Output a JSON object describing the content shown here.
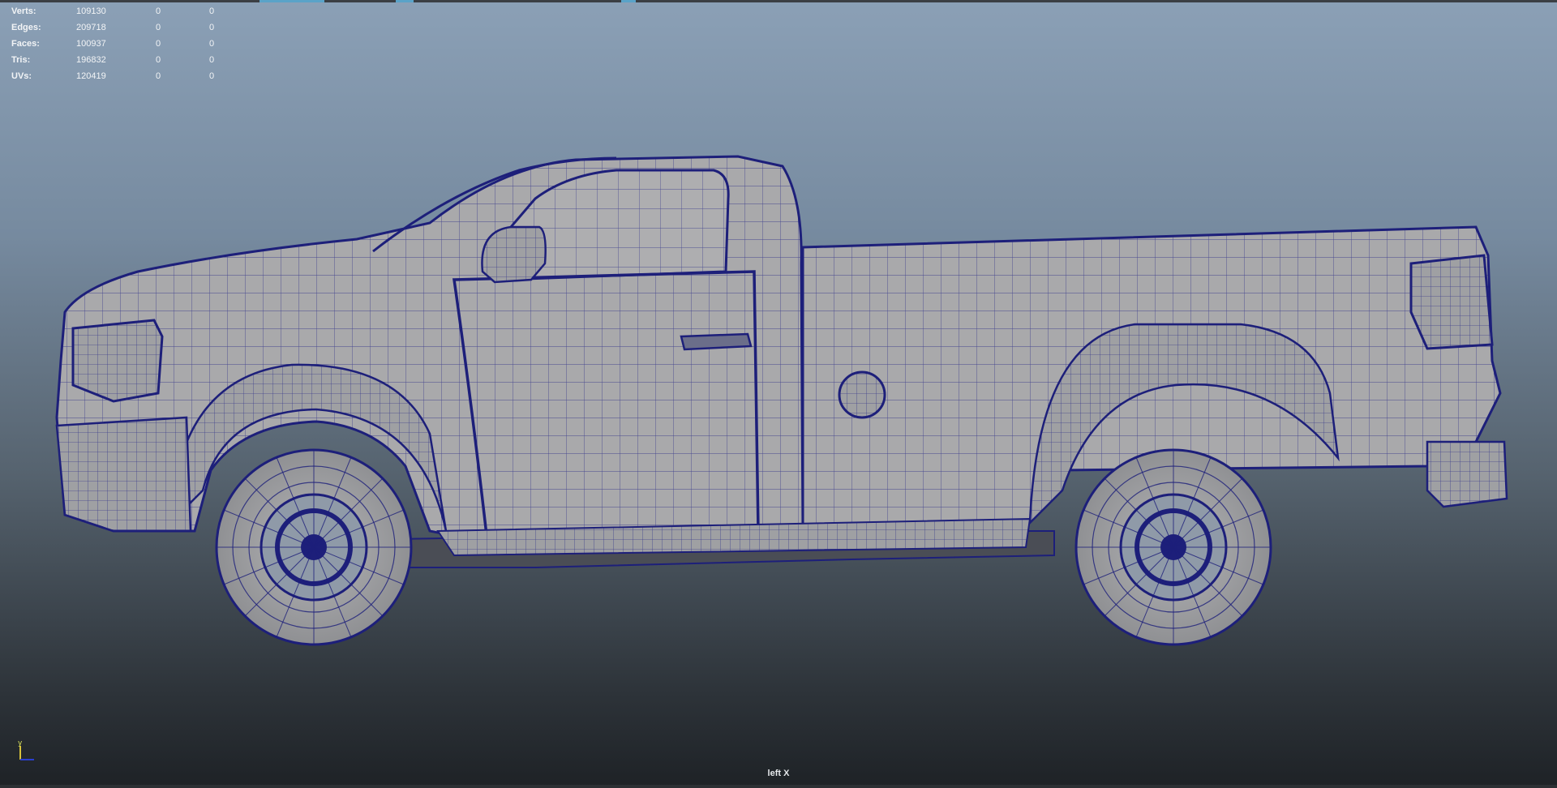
{
  "hud": {
    "rows": [
      {
        "label": "Verts:",
        "v1": "109130",
        "v2": "0",
        "v3": "0"
      },
      {
        "label": "Edges:",
        "v1": "209718",
        "v2": "0",
        "v3": "0"
      },
      {
        "label": "Faces:",
        "v1": "100937",
        "v2": "0",
        "v3": "0"
      },
      {
        "label": "Tris:",
        "v1": "196832",
        "v2": "0",
        "v3": "0"
      },
      {
        "label": "UVs:",
        "v1": "120419",
        "v2": "0",
        "v3": "0"
      }
    ]
  },
  "viewport": {
    "camera_label": "left X",
    "axis_icon": "axis-gizmo-icon",
    "axis_label": "y",
    "model_icon": "pickup-truck-wireframe"
  },
  "colors": {
    "wire": "#1d1f7a",
    "body": "#a8a8a8",
    "bg_top": "#8ba0b6",
    "bg_bottom": "#1e2226"
  }
}
